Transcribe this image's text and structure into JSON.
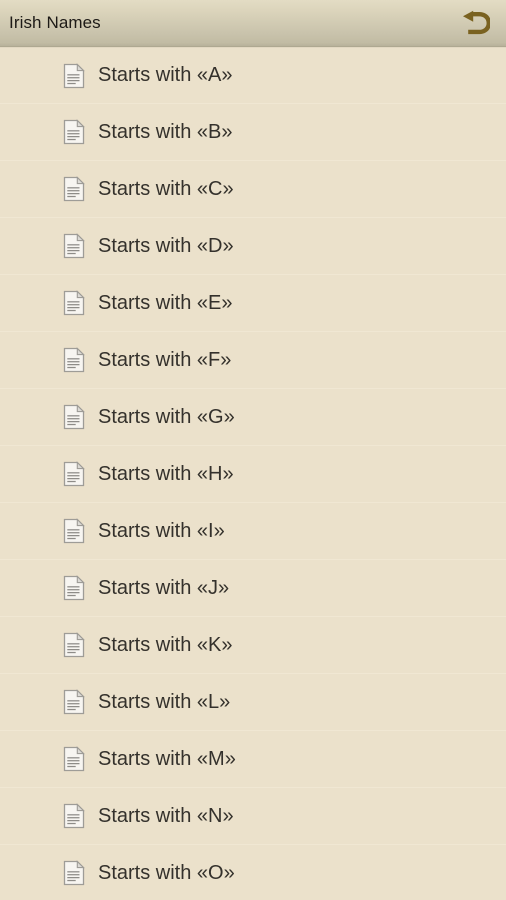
{
  "window": {
    "title": "Irish Names",
    "background_color": "#EBE1CB",
    "titlebar_color": "#DCD5BC",
    "accent_color": "#7A6220"
  },
  "titlebar": {
    "title": "Irish Names",
    "back_button": {
      "name": "back-icon",
      "label": "Back",
      "color": "#7A6220"
    }
  },
  "list": {
    "item_icon": "document-icon",
    "items": [
      {
        "label": "Starts with «A»",
        "letter": "A"
      },
      {
        "label": "Starts with «B»",
        "letter": "B"
      },
      {
        "label": "Starts with «C»",
        "letter": "C"
      },
      {
        "label": "Starts with «D»",
        "letter": "D"
      },
      {
        "label": "Starts with «E»",
        "letter": "E"
      },
      {
        "label": "Starts with «F»",
        "letter": "F"
      },
      {
        "label": "Starts with «G»",
        "letter": "G"
      },
      {
        "label": "Starts with «H»",
        "letter": "H"
      },
      {
        "label": "Starts with «I»",
        "letter": "I"
      },
      {
        "label": "Starts with «J»",
        "letter": "J"
      },
      {
        "label": "Starts with «K»",
        "letter": "K"
      },
      {
        "label": "Starts with «L»",
        "letter": "L"
      },
      {
        "label": "Starts with «M»",
        "letter": "M"
      },
      {
        "label": "Starts with «N»",
        "letter": "N"
      },
      {
        "label": "Starts with «O»",
        "letter": "O"
      }
    ]
  }
}
